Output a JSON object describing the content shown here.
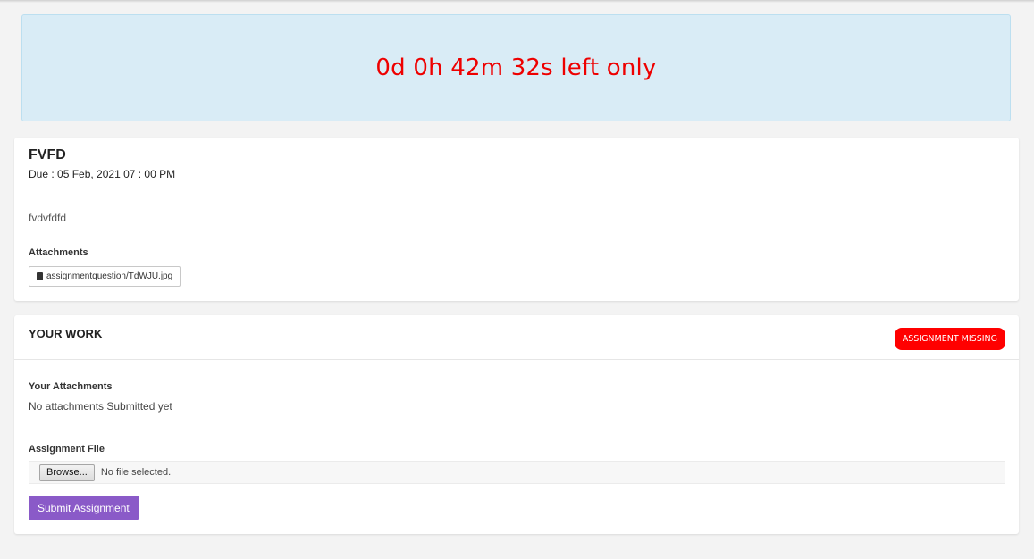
{
  "countdown": {
    "text": "0d 0h 42m 32s left only",
    "color": "#ee0000",
    "background": "#d9ecf6"
  },
  "assignment": {
    "title": "FVFD",
    "due": "Due : 05 Feb, 2021 07 : 00 PM",
    "description": "fvdvfdfd",
    "attachments_label": "Attachments",
    "attachments": [
      {
        "icon": "book-icon",
        "name": "assignmentquestion/TdWJU.jpg"
      }
    ]
  },
  "work": {
    "title": "YOUR WORK",
    "status_badge": "ASSIGNMENT MISSING",
    "status_color": "#ff0000",
    "your_attachments_label": "Your Attachments",
    "no_attachments_text": "No attachments Submitted yet",
    "file_label": "Assignment File",
    "browse_label": "Browse...",
    "file_status": "No file selected.",
    "submit_label": "Submit Assignment",
    "submit_color": "#8a5ac8"
  }
}
